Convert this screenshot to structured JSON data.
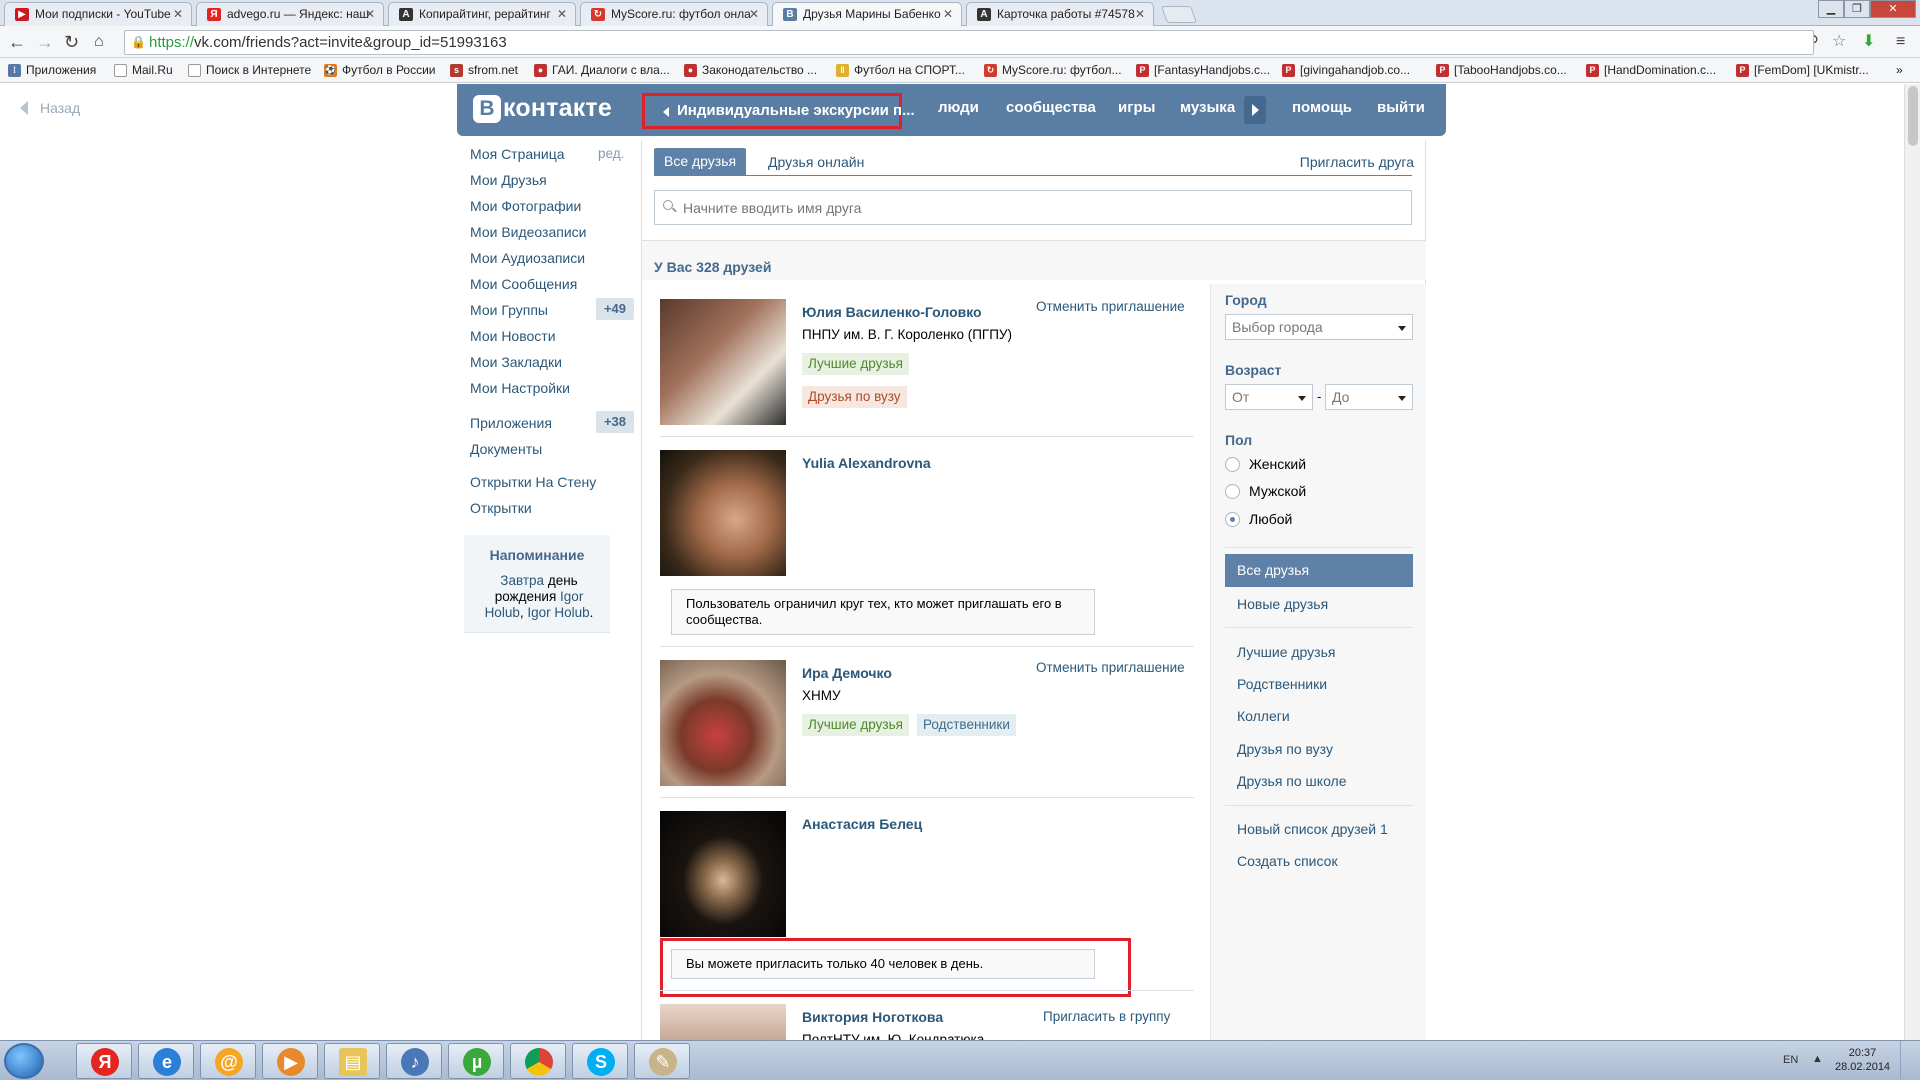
{
  "browser": {
    "tabs": [
      {
        "title": "Мои подписки - YouTube",
        "favicon_color": "#cc181e",
        "favicon": "youtube-icon"
      },
      {
        "title": "advego.ru — Яндекс: наш",
        "favicon_color": "#e52620",
        "favicon": "yandex-icon"
      },
      {
        "title": "Копирайтинг, рерайтинг",
        "favicon_color": "#333333",
        "favicon": "advego-icon"
      },
      {
        "title": "MyScore.ru: футбол онла",
        "favicon_color": "#d33a2c",
        "favicon": "myscore-icon"
      },
      {
        "title": "Друзья Марины Бабенко",
        "favicon_color": "#597da3",
        "favicon": "vk-icon"
      },
      {
        "title": "Карточка работы #74578",
        "favicon_color": "#333333",
        "favicon": "advego-icon"
      }
    ],
    "url_scheme": "https://",
    "url_rest": "vk.com/friends?act=invite&group_id=51993163",
    "bookmarks": [
      {
        "label": "Приложения",
        "icon_color": "#5577aa"
      },
      {
        "label": "Mail.Ru",
        "icon_color": "#888888"
      },
      {
        "label": "Поиск в Интернете",
        "icon_color": "#888888"
      },
      {
        "label": "Футбол в России",
        "icon_color": "#e07c1a"
      },
      {
        "label": "sfrom.net",
        "icon_color": "#b33b2e"
      },
      {
        "label": "ГАИ. Диалоги с вла...",
        "icon_color": "#c03030"
      },
      {
        "label": "Законодательство ...",
        "icon_color": "#c03030"
      },
      {
        "label": "Футбол на СПОРТ...",
        "icon_color": "#e0b030"
      },
      {
        "label": "MyScore.ru: футбол...",
        "icon_color": "#d33a2c"
      },
      {
        "label": "[FantasyHandjobs.c...",
        "icon_color": "#c03030"
      },
      {
        "label": "[givingahandjob.co...",
        "icon_color": "#c03030"
      },
      {
        "label": "[TabooHandjobs.co...",
        "icon_color": "#c03030"
      },
      {
        "label": "[HandDomination.c...",
        "icon_color": "#c03030"
      },
      {
        "label": "[FemDom] [UKmistr...",
        "icon_color": "#c03030"
      }
    ]
  },
  "vk": {
    "back_label": "Назад",
    "logo_letter": "В",
    "logo_text": "контакте",
    "nav": {
      "group_back": "Индивидуальные экскурсии п...",
      "people": "люди",
      "communities": "сообщества",
      "games": "игры",
      "music": "музыка",
      "help": "помощь",
      "logout": "выйти"
    },
    "left_menu": [
      {
        "label": "Моя Страница"
      },
      {
        "label": "Мои Друзья"
      },
      {
        "label": "Мои Фотографии"
      },
      {
        "label": "Мои Видеозаписи"
      },
      {
        "label": "Мои Аудиозаписи"
      },
      {
        "label": "Мои Сообщения"
      },
      {
        "label": "Мои Группы"
      },
      {
        "label": "Мои Новости"
      },
      {
        "label": "Мои Закладки"
      },
      {
        "label": "Мои Настройки"
      },
      {
        "label": "Приложения"
      },
      {
        "label": "Документы"
      },
      {
        "label": "Открытки На Стену"
      },
      {
        "label": "Открытки"
      }
    ],
    "edit_label": "ред.",
    "groups_count": "+49",
    "apps_count": "+38",
    "reminder": {
      "title": "Напоминание",
      "tomorrow": "Завтра",
      "text1": "день рождения",
      "name1": "Igor Holub",
      "name2": "Igor Holub"
    },
    "tabs": {
      "all": "Все друзья",
      "online": "Друзья онлайн",
      "invite": "Пригласить друга"
    },
    "search_placeholder": "Начните вводить имя друга",
    "friends_count_text": "У Вас 328 друзей",
    "friends": [
      {
        "name": "Юлия Василенко-Головко",
        "sub": "ПНПУ им. В. Г. Короленко (ПГПУ)",
        "tags": [
          "Лучшие друзья",
          "Друзья по вузу"
        ],
        "action": "Отменить приглашение"
      },
      {
        "name": "Yulia Alexandrovna",
        "notice": "Пользователь ограничил круг тех, кто может приглашать его в сообщества."
      },
      {
        "name": "Ира Демочко",
        "sub": "ХНМУ",
        "tags": [
          "Лучшие друзья",
          "Родственники"
        ],
        "action": "Отменить приглашение"
      },
      {
        "name": "Анастасия Белец",
        "notice": "Вы можете пригласить только 40 человек в день."
      },
      {
        "name": "Виктория Ноготкова",
        "sub": "ПолтНТУ им. Ю. Кондратюка",
        "action": "Пригласить в группу"
      }
    ],
    "filters": {
      "city_label": "Город",
      "city_value": "Выбор города",
      "age_label": "Возраст",
      "age_from": "От",
      "age_dash": "-",
      "age_to": "До",
      "sex_label": "Пол",
      "sex_female": "Женский",
      "sex_male": "Мужской",
      "sex_any": "Любой",
      "lists": [
        "Все друзья",
        "Новые друзья",
        "Лучшие друзья",
        "Родственники",
        "Коллеги",
        "Друзья по вузу",
        "Друзья по школе",
        "Новый список друзей 1",
        "Создать список"
      ]
    }
  },
  "taskbar": {
    "lang": "EN",
    "time": "20:37",
    "date": "28.02.2014"
  }
}
